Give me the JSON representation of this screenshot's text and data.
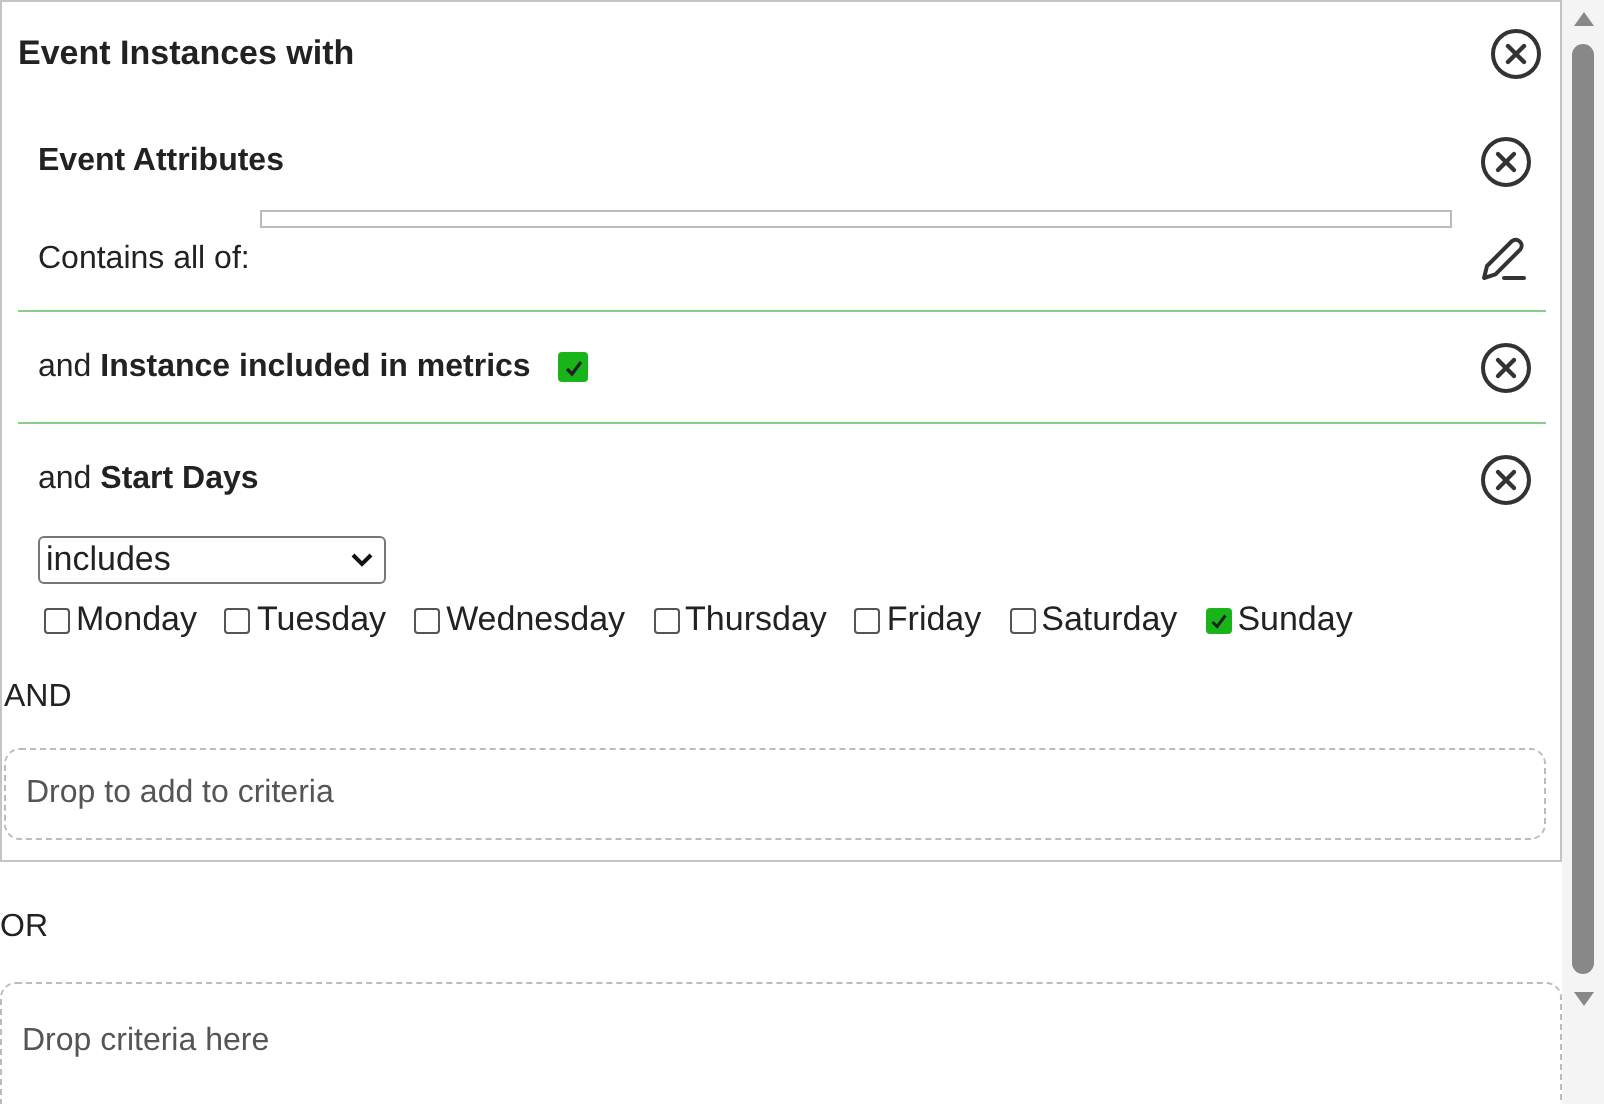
{
  "group": {
    "title": "Event Instances with",
    "criteria": [
      {
        "kind": "attributes",
        "title": "Event Attributes",
        "label": "Contains all of:"
      },
      {
        "kind": "flag",
        "prefix": "and",
        "title": "Instance included in metrics",
        "checked": true
      },
      {
        "kind": "days",
        "prefix": "and",
        "title": "Start Days",
        "select_value": "includes",
        "days": [
          {
            "label": "Monday",
            "checked": false
          },
          {
            "label": "Tuesday",
            "checked": false
          },
          {
            "label": "Wednesday",
            "checked": false
          },
          {
            "label": "Thursday",
            "checked": false
          },
          {
            "label": "Friday",
            "checked": false
          },
          {
            "label": "Saturday",
            "checked": false
          },
          {
            "label": "Sunday",
            "checked": true
          }
        ]
      }
    ],
    "join": "AND",
    "drop_placeholder": "Drop to add to criteria"
  },
  "or_label": "OR",
  "or_drop_placeholder": "Drop criteria here"
}
